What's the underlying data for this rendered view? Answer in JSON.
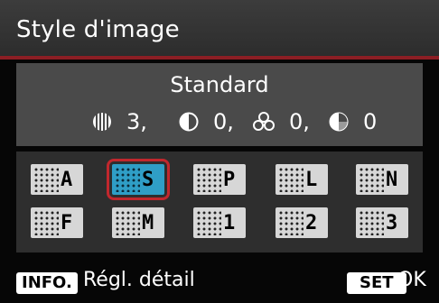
{
  "menu": {
    "title": "Style d'image"
  },
  "current_style": {
    "name": "Standard"
  },
  "parameters": [
    {
      "icon": "sharpness-icon",
      "value": "3,"
    },
    {
      "icon": "contrast-icon",
      "value": "0,"
    },
    {
      "icon": "saturation-icon",
      "value": "0,"
    },
    {
      "icon": "color-tone-icon",
      "value": "0"
    }
  ],
  "styles": [
    {
      "code": "A",
      "selected": false
    },
    {
      "code": "S",
      "selected": true
    },
    {
      "code": "P",
      "selected": false
    },
    {
      "code": "L",
      "selected": false
    },
    {
      "code": "N",
      "selected": false
    },
    {
      "code": "F",
      "selected": false
    },
    {
      "code": "M",
      "selected": false
    },
    {
      "code": "1",
      "selected": false
    },
    {
      "code": "2",
      "selected": false
    },
    {
      "code": "3",
      "selected": false
    }
  ],
  "footer": {
    "info_key": "INFO.",
    "info_label": "Régl. détail",
    "set_key": "SET",
    "set_label": "OK"
  },
  "colors": {
    "title_rule": "#8c1e24",
    "selection": "#c1272d",
    "selected_fill": "#2f9ec6"
  }
}
